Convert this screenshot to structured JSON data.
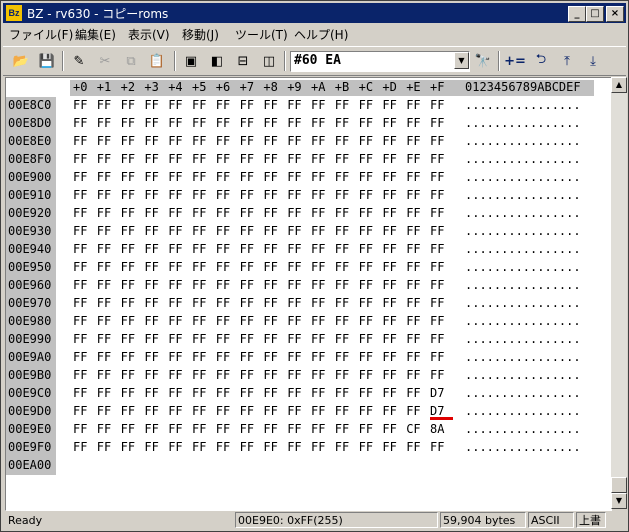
{
  "window": {
    "title": "BZ - rv630 - コピーroms",
    "app_icon": "Bz"
  },
  "controls": {
    "minimize": "_",
    "maximize": "□",
    "close": "×"
  },
  "menu": [
    {
      "label": "ファイル(F)"
    },
    {
      "label": "編集(E)"
    },
    {
      "label": "表示(V)"
    },
    {
      "label": "移動(J)"
    },
    {
      "label": "ツール(T)"
    },
    {
      "label": "ヘルプ(H)"
    }
  ],
  "toolbar": {
    "search_value": "#60 EA",
    "tools": [
      {
        "name": "open-folder-icon",
        "glyph": "📂"
      },
      {
        "name": "save-icon",
        "glyph": "💾"
      },
      {
        "name": "edit-icon",
        "glyph": "✎"
      },
      {
        "name": "cut-icon",
        "glyph": "✂"
      },
      {
        "name": "copy-icon",
        "glyph": "⧉"
      },
      {
        "name": "paste-icon",
        "glyph": "📋"
      },
      {
        "name": "view-single-icon",
        "glyph": "▣"
      },
      {
        "name": "view-split-icon",
        "glyph": "◧"
      },
      {
        "name": "view-horizontal-icon",
        "glyph": "⊟"
      },
      {
        "name": "view-vertical-icon",
        "glyph": "◫"
      },
      {
        "name": "binoculars-icon",
        "glyph": "🔭"
      },
      {
        "name": "add-assign-icon",
        "glyph": "+="
      },
      {
        "name": "back-icon",
        "glyph": "⮌"
      },
      {
        "name": "jump-top-icon",
        "glyph": "⤒"
      },
      {
        "name": "jump-down-icon",
        "glyph": "⤓"
      }
    ]
  },
  "hex": {
    "header_cols": [
      "+0",
      "+1",
      "+2",
      "+3",
      "+4",
      "+5",
      "+6",
      "+7",
      "+8",
      "+9",
      "+A",
      "+B",
      "+C",
      "+D",
      "+E",
      "+F"
    ],
    "ascii_header": "0123456789ABCDEF",
    "rows": [
      {
        "addr": "00E8C0",
        "bytes": [
          "FF",
          "FF",
          "FF",
          "FF",
          "FF",
          "FF",
          "FF",
          "FF",
          "FF",
          "FF",
          "FF",
          "FF",
          "FF",
          "FF",
          "FF",
          "FF"
        ],
        "ascii": "................"
      },
      {
        "addr": "00E8D0",
        "bytes": [
          "FF",
          "FF",
          "FF",
          "FF",
          "FF",
          "FF",
          "FF",
          "FF",
          "FF",
          "FF",
          "FF",
          "FF",
          "FF",
          "FF",
          "FF",
          "FF"
        ],
        "ascii": "................"
      },
      {
        "addr": "00E8E0",
        "bytes": [
          "FF",
          "FF",
          "FF",
          "FF",
          "FF",
          "FF",
          "FF",
          "FF",
          "FF",
          "FF",
          "FF",
          "FF",
          "FF",
          "FF",
          "FF",
          "FF"
        ],
        "ascii": "................"
      },
      {
        "addr": "00E8F0",
        "bytes": [
          "FF",
          "FF",
          "FF",
          "FF",
          "FF",
          "FF",
          "FF",
          "FF",
          "FF",
          "FF",
          "FF",
          "FF",
          "FF",
          "FF",
          "FF",
          "FF"
        ],
        "ascii": "................"
      },
      {
        "addr": "00E900",
        "bytes": [
          "FF",
          "FF",
          "FF",
          "FF",
          "FF",
          "FF",
          "FF",
          "FF",
          "FF",
          "FF",
          "FF",
          "FF",
          "FF",
          "FF",
          "FF",
          "FF"
        ],
        "ascii": "................"
      },
      {
        "addr": "00E910",
        "bytes": [
          "FF",
          "FF",
          "FF",
          "FF",
          "FF",
          "FF",
          "FF",
          "FF",
          "FF",
          "FF",
          "FF",
          "FF",
          "FF",
          "FF",
          "FF",
          "FF"
        ],
        "ascii": "................"
      },
      {
        "addr": "00E920",
        "bytes": [
          "FF",
          "FF",
          "FF",
          "FF",
          "FF",
          "FF",
          "FF",
          "FF",
          "FF",
          "FF",
          "FF",
          "FF",
          "FF",
          "FF",
          "FF",
          "FF"
        ],
        "ascii": "................"
      },
      {
        "addr": "00E930",
        "bytes": [
          "FF",
          "FF",
          "FF",
          "FF",
          "FF",
          "FF",
          "FF",
          "FF",
          "FF",
          "FF",
          "FF",
          "FF",
          "FF",
          "FF",
          "FF",
          "FF"
        ],
        "ascii": "................"
      },
      {
        "addr": "00E940",
        "bytes": [
          "FF",
          "FF",
          "FF",
          "FF",
          "FF",
          "FF",
          "FF",
          "FF",
          "FF",
          "FF",
          "FF",
          "FF",
          "FF",
          "FF",
          "FF",
          "FF"
        ],
        "ascii": "................"
      },
      {
        "addr": "00E950",
        "bytes": [
          "FF",
          "FF",
          "FF",
          "FF",
          "FF",
          "FF",
          "FF",
          "FF",
          "FF",
          "FF",
          "FF",
          "FF",
          "FF",
          "FF",
          "FF",
          "FF"
        ],
        "ascii": "................"
      },
      {
        "addr": "00E960",
        "bytes": [
          "FF",
          "FF",
          "FF",
          "FF",
          "FF",
          "FF",
          "FF",
          "FF",
          "FF",
          "FF",
          "FF",
          "FF",
          "FF",
          "FF",
          "FF",
          "FF"
        ],
        "ascii": "................"
      },
      {
        "addr": "00E970",
        "bytes": [
          "FF",
          "FF",
          "FF",
          "FF",
          "FF",
          "FF",
          "FF",
          "FF",
          "FF",
          "FF",
          "FF",
          "FF",
          "FF",
          "FF",
          "FF",
          "FF"
        ],
        "ascii": "................"
      },
      {
        "addr": "00E980",
        "bytes": [
          "FF",
          "FF",
          "FF",
          "FF",
          "FF",
          "FF",
          "FF",
          "FF",
          "FF",
          "FF",
          "FF",
          "FF",
          "FF",
          "FF",
          "FF",
          "FF"
        ],
        "ascii": "................"
      },
      {
        "addr": "00E990",
        "bytes": [
          "FF",
          "FF",
          "FF",
          "FF",
          "FF",
          "FF",
          "FF",
          "FF",
          "FF",
          "FF",
          "FF",
          "FF",
          "FF",
          "FF",
          "FF",
          "FF"
        ],
        "ascii": "................"
      },
      {
        "addr": "00E9A0",
        "bytes": [
          "FF",
          "FF",
          "FF",
          "FF",
          "FF",
          "FF",
          "FF",
          "FF",
          "FF",
          "FF",
          "FF",
          "FF",
          "FF",
          "FF",
          "FF",
          "FF"
        ],
        "ascii": "................"
      },
      {
        "addr": "00E9B0",
        "bytes": [
          "FF",
          "FF",
          "FF",
          "FF",
          "FF",
          "FF",
          "FF",
          "FF",
          "FF",
          "FF",
          "FF",
          "FF",
          "FF",
          "FF",
          "FF",
          "FF"
        ],
        "ascii": "................"
      },
      {
        "addr": "00E9C0",
        "bytes": [
          "FF",
          "FF",
          "FF",
          "FF",
          "FF",
          "FF",
          "FF",
          "FF",
          "FF",
          "FF",
          "FF",
          "FF",
          "FF",
          "FF",
          "FF",
          "D7"
        ],
        "ascii": "................"
      },
      {
        "addr": "00E9D0",
        "bytes": [
          "FF",
          "FF",
          "FF",
          "FF",
          "FF",
          "FF",
          "FF",
          "FF",
          "FF",
          "FF",
          "FF",
          "FF",
          "FF",
          "FF",
          "FF",
          "D7"
        ],
        "ascii": "................"
      },
      {
        "addr": "00E9E0",
        "bytes": [
          "FF",
          "FF",
          "FF",
          "FF",
          "FF",
          "FF",
          "FF",
          "FF",
          "FF",
          "FF",
          "FF",
          "FF",
          "FF",
          "FF",
          "CF",
          "8A"
        ],
        "ascii": "................"
      },
      {
        "addr": "00E9F0",
        "bytes": [
          "FF",
          "FF",
          "FF",
          "FF",
          "FF",
          "FF",
          "FF",
          "FF",
          "FF",
          "FF",
          "FF",
          "FF",
          "FF",
          "FF",
          "FF",
          "FF"
        ],
        "ascii": "................"
      },
      {
        "addr": "00EA00",
        "bytes": [],
        "ascii": ""
      }
    ],
    "highlight_color": "#e00000"
  },
  "status": {
    "state": "Ready",
    "position": "00E9E0: 0xFF(255)",
    "size": "59,904 bytes",
    "encoding": "ASCII",
    "mode": "上書"
  }
}
